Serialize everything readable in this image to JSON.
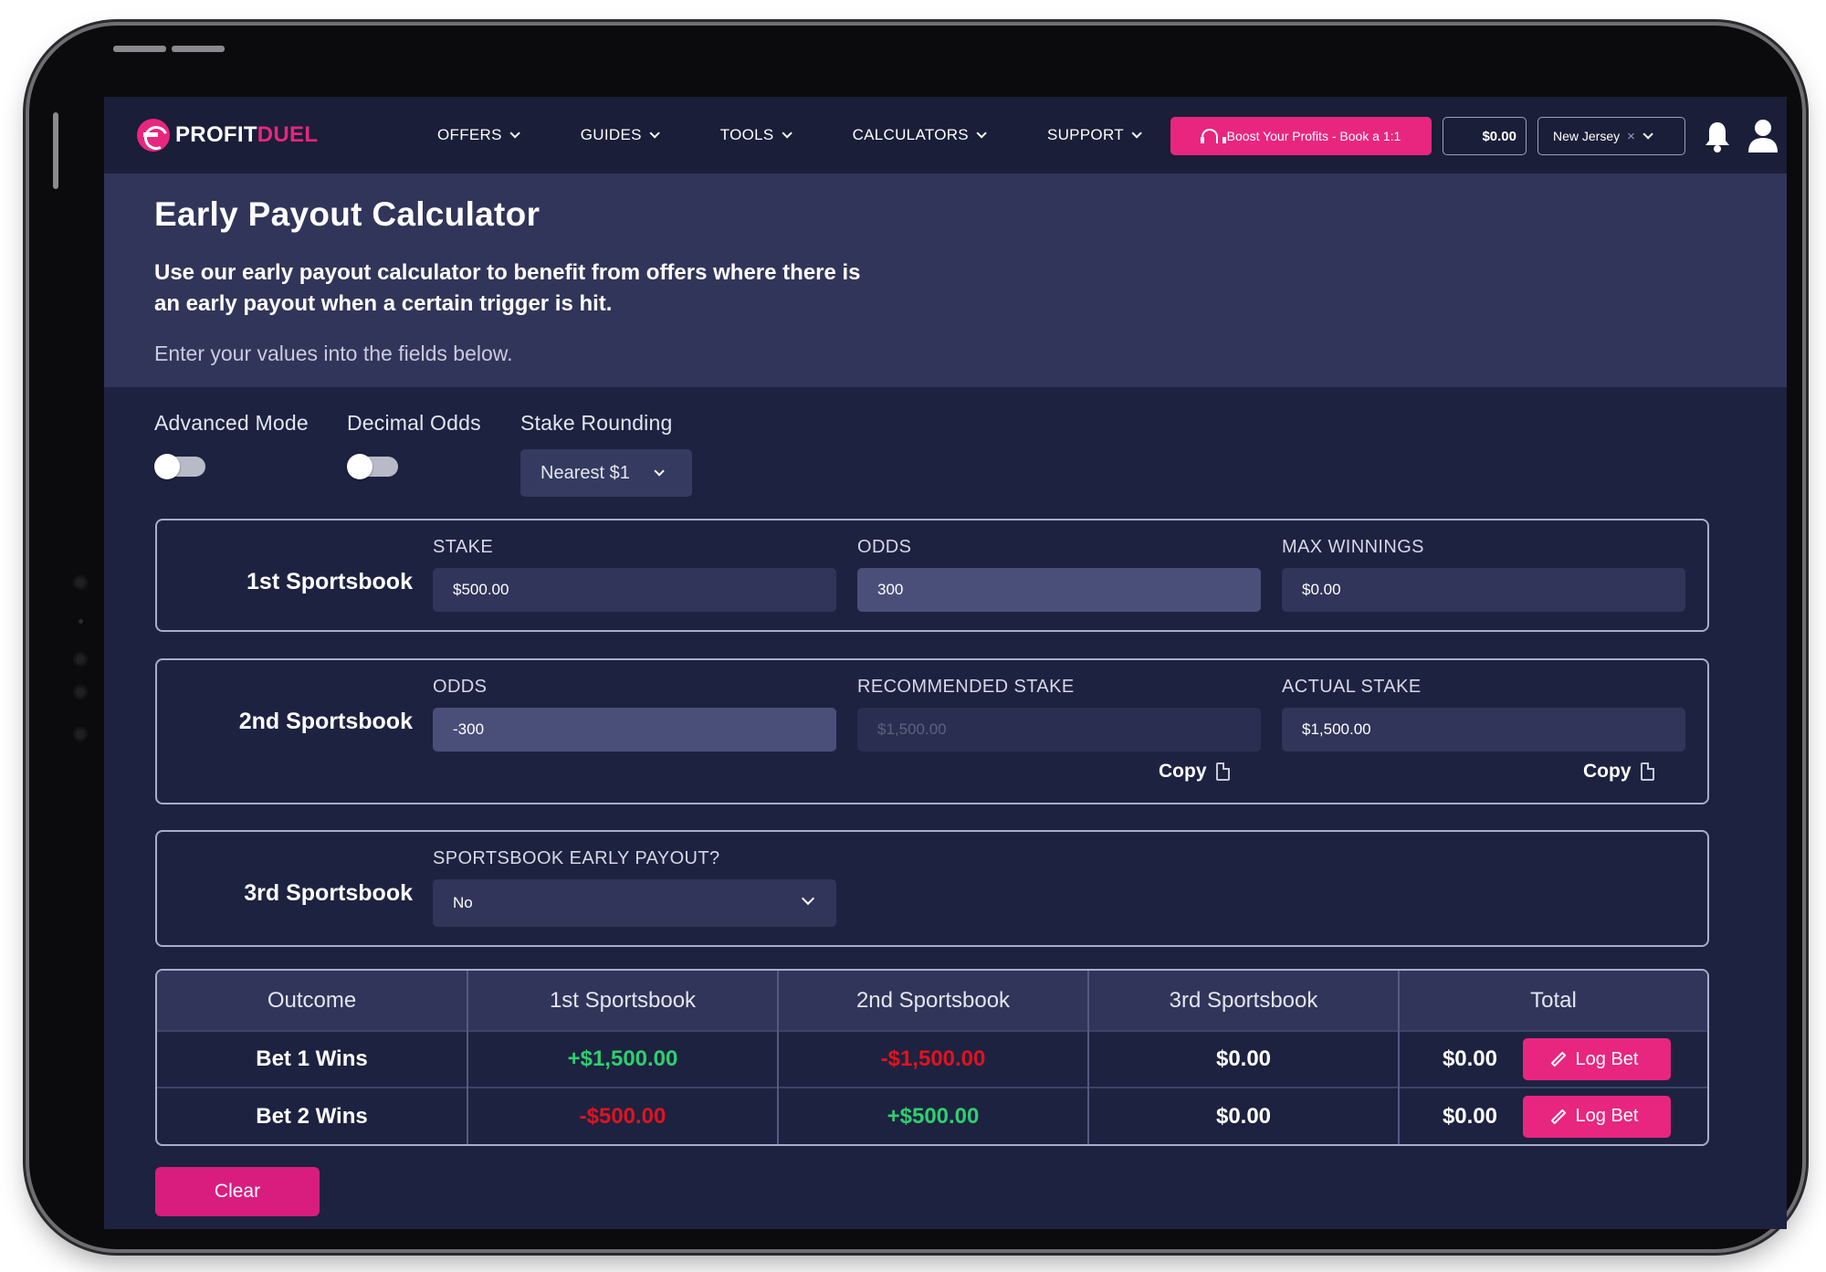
{
  "nav": {
    "logo_profit": "PROFIT",
    "logo_duel": "DUEL",
    "items": [
      {
        "label": "OFFERS"
      },
      {
        "label": "GUIDES"
      },
      {
        "label": "TOOLS"
      },
      {
        "label": "CALCULATORS"
      },
      {
        "label": "SUPPORT"
      }
    ],
    "boost_label": "Boost Your Profits - Book a 1:1",
    "balance": "$0.00",
    "state": "New Jersey",
    "state_clear": "×"
  },
  "hero": {
    "title": "Early Payout Calculator",
    "lead": "Use our early payout calculator to benefit from offers where there is an early payout when a certain trigger is hit.",
    "sub": "Enter your values into the fields below."
  },
  "options": {
    "advanced_label": "Advanced Mode",
    "advanced_on": false,
    "decimal_label": "Decimal Odds",
    "decimal_on": false,
    "rounding_label": "Stake Rounding",
    "rounding_value": "Nearest $1"
  },
  "book1": {
    "title": "1st Sportsbook",
    "stake_label": "STAKE",
    "stake_value": "$500.00",
    "odds_label": "ODDS",
    "odds_value": "300",
    "max_label": "MAX WINNINGS",
    "max_value": "$0.00"
  },
  "book2": {
    "title": "2nd Sportsbook",
    "odds_label": "ODDS",
    "odds_value": "-300",
    "rec_label": "RECOMMENDED STAKE",
    "rec_placeholder": "$1,500.00",
    "actual_label": "ACTUAL STAKE",
    "actual_value": "$1,500.00",
    "copy_label": "Copy"
  },
  "book3": {
    "title": "3rd Sportsbook",
    "early_label": "SPORTSBOOK EARLY PAYOUT?",
    "early_value": "No"
  },
  "results": {
    "headers": [
      "Outcome",
      "1st Sportsbook",
      "2nd Sportsbook",
      "3rd Sportsbook",
      "Total"
    ],
    "rows": [
      {
        "outcome": "Bet 1 Wins",
        "b1": "+$1,500.00",
        "b2": "-$1,500.00",
        "b3": "$0.00",
        "total": "$0.00"
      },
      {
        "outcome": "Bet 2 Wins",
        "b1": "-$500.00",
        "b2": "+$500.00",
        "b3": "$0.00",
        "total": "$0.00"
      }
    ],
    "log_bet_label": "Log Bet"
  },
  "clear_label": "Clear",
  "colors": {
    "accent": "#e8267f",
    "positive": "#2ecf6f",
    "negative": "#e0131f",
    "background": "#1d2240"
  }
}
